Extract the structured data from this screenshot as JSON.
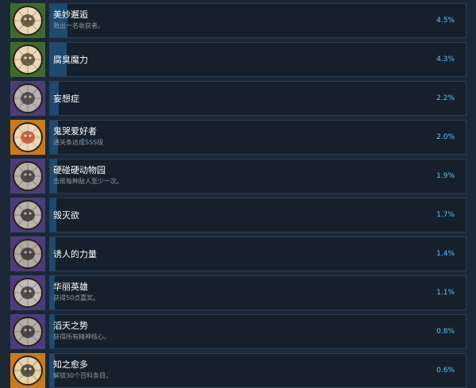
{
  "achievements": [
    {
      "title": "美妙邂逅",
      "desc": "救出一名收获者。",
      "percent": "4.5%",
      "value": 4.5,
      "icon": "deer-skull-wheel-icon",
      "frame": "#3f6a2e",
      "bg": "#e9d9b8",
      "glyph": "#4a3a25"
    },
    {
      "title": "腐臭魔力",
      "desc": "",
      "percent": "4.3%",
      "value": 4.3,
      "icon": "creature-wheel-icon",
      "frame": "#3f6a2e",
      "bg": "#e9d9b8",
      "glyph": "#4a3a25"
    },
    {
      "title": "妄想症",
      "desc": "",
      "percent": "2.2%",
      "value": 2.2,
      "icon": "tangled-face-icon",
      "frame": "#4a3d78",
      "bg": "#b8b1b0",
      "glyph": "#3a3030"
    },
    {
      "title": "鬼哭爱好者",
      "desc": "通关条达成SSS级",
      "percent": "2.0%",
      "value": 2.0,
      "icon": "sss-rank-icon",
      "frame": "#c77b1e",
      "bg": "#e9d9b8",
      "glyph": "#b8421e"
    },
    {
      "title": "硬碰硬动物园",
      "desc": "击败每种敌人至少一次。",
      "percent": "1.9%",
      "value": 1.9,
      "icon": "creatures-icon",
      "frame": "#4a3d78",
      "bg": "#b9b1aa",
      "glyph": "#2f2a2a"
    },
    {
      "title": "毁灭欲",
      "desc": "",
      "percent": "1.7%",
      "value": 1.7,
      "icon": "destruction-icon",
      "frame": "#4a3d78",
      "bg": "#bab3ac",
      "glyph": "#2b2626"
    },
    {
      "title": "诱人的力量",
      "desc": "",
      "percent": "1.4%",
      "value": 1.4,
      "icon": "crown-face-icon",
      "frame": "#4a3d78",
      "bg": "#b3a9a2",
      "glyph": "#2b2626"
    },
    {
      "title": "华丽英雄",
      "desc": "获得50点嘉奖。",
      "percent": "1.1%",
      "value": 1.1,
      "icon": "hero-face-icon",
      "frame": "#4a3d78",
      "bg": "#c2bbb5",
      "glyph": "#2f2a2a"
    },
    {
      "title": "滔天之势",
      "desc": "获得所有精神核心。",
      "percent": "0.8%",
      "value": 0.8,
      "icon": "spirit-core-icon",
      "frame": "#4a3d78",
      "bg": "#b5aca5",
      "glyph": "#2b2626"
    },
    {
      "title": "知之愈多",
      "desc": "解锁30个百科条目。",
      "percent": "0.6%",
      "value": 0.6,
      "icon": "pineapple-icon",
      "frame": "#c77b1e",
      "bg": "#e6d3a8",
      "glyph": "#2f2a2a"
    }
  ]
}
